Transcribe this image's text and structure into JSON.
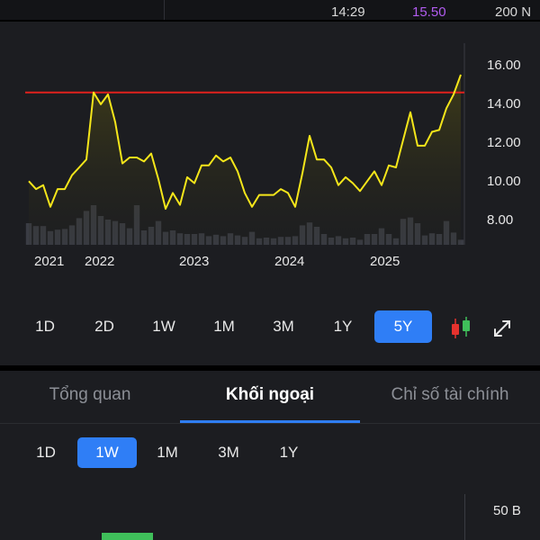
{
  "top_row": {
    "time": "14:29",
    "price": "15.50",
    "volume": "200 N"
  },
  "chart_data": {
    "type": "line",
    "x_labels": [
      "2021",
      "2022",
      "2023",
      "2024",
      "2025"
    ],
    "y_ticks": [
      "16.00",
      "14.00",
      "12.00",
      "10.00",
      "8.00"
    ],
    "ylim": [
      7.0,
      17.0
    ],
    "line_color": "#f5e61a",
    "resistance_level": 14.5,
    "resistance_color": "#e0211d",
    "price": [
      10.0,
      9.6,
      9.8,
      8.7,
      9.6,
      9.6,
      10.3,
      10.7,
      11.1,
      14.5,
      13.9,
      14.4,
      13.0,
      10.9,
      11.2,
      11.2,
      11.0,
      11.4,
      10.1,
      8.6,
      9.4,
      8.8,
      10.2,
      9.9,
      10.8,
      10.8,
      11.3,
      11.0,
      11.2,
      10.5,
      9.4,
      8.7,
      9.3,
      9.3,
      9.3,
      9.6,
      9.4,
      8.7,
      10.4,
      12.3,
      11.1,
      11.1,
      10.7,
      9.8,
      10.2,
      9.9,
      9.5,
      10.0,
      10.5,
      9.8,
      10.8,
      10.7,
      12.1,
      13.5,
      11.8,
      11.8,
      12.5,
      12.6,
      13.7,
      14.4,
      15.4
    ],
    "volume": [
      0.3,
      0.26,
      0.26,
      0.19,
      0.21,
      0.22,
      0.27,
      0.37,
      0.47,
      0.55,
      0.4,
      0.35,
      0.33,
      0.3,
      0.23,
      0.55,
      0.2,
      0.25,
      0.33,
      0.18,
      0.2,
      0.16,
      0.15,
      0.15,
      0.16,
      0.12,
      0.14,
      0.12,
      0.16,
      0.13,
      0.11,
      0.18,
      0.09,
      0.1,
      0.09,
      0.11,
      0.11,
      0.12,
      0.27,
      0.31,
      0.25,
      0.15,
      0.1,
      0.12,
      0.09,
      0.1,
      0.07,
      0.15,
      0.15,
      0.23,
      0.15,
      0.09,
      0.36,
      0.38,
      0.3,
      0.13,
      0.16,
      0.15,
      0.33,
      0.17,
      0.07
    ]
  },
  "range_buttons": [
    "1D",
    "2D",
    "1W",
    "1M",
    "3M",
    "1Y",
    "5Y"
  ],
  "active_range": "5Y",
  "tabs": [
    "Tổng quan",
    "Khối ngoại",
    "Chỉ số tài chính"
  ],
  "active_tab": "Khối ngoại",
  "periods": [
    "1D",
    "1W",
    "1M",
    "3M",
    "1Y"
  ],
  "active_period": "1W",
  "foreign_chart": {
    "y_label": "50 B",
    "bar_color": "#3fbf5a"
  },
  "icons": {
    "candlestick": "candlestick-icon",
    "expand": "expand-icon"
  },
  "colors": {
    "accent": "#2f7ef6",
    "price_purple": "#b25cf0",
    "volume_green": "#3fbf5a"
  }
}
